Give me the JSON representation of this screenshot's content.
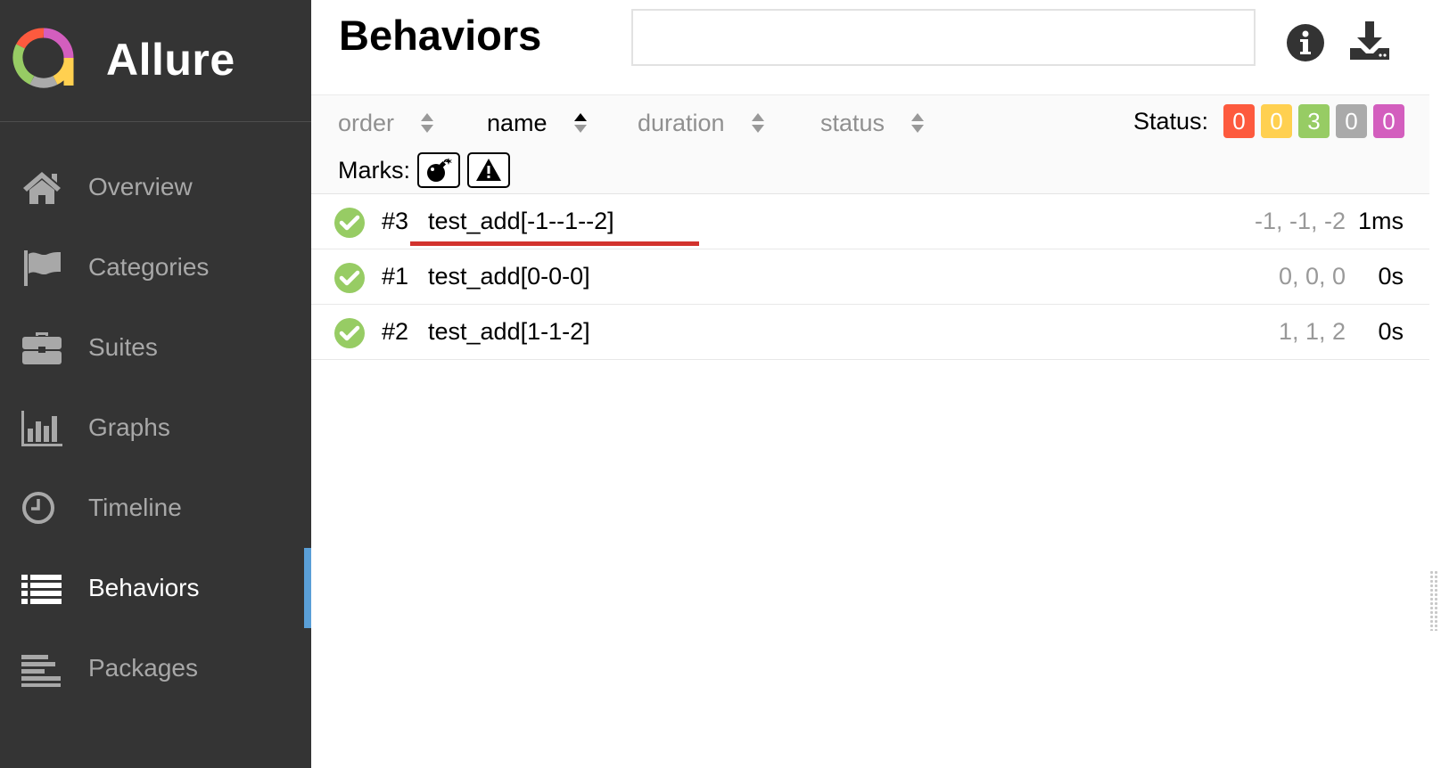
{
  "app": {
    "brand_name": "Allure",
    "logo_colors": [
      "#97cc64",
      "#fd5a3e",
      "#aaaaaa",
      "#ffd050",
      "#d35ebe"
    ]
  },
  "sidebar": {
    "items": [
      {
        "label": "Overview",
        "icon": "home-icon",
        "active": false
      },
      {
        "label": "Categories",
        "icon": "flag-icon",
        "active": false
      },
      {
        "label": "Suites",
        "icon": "briefcase-icon",
        "active": false
      },
      {
        "label": "Graphs",
        "icon": "bar-chart-icon",
        "active": false
      },
      {
        "label": "Timeline",
        "icon": "clock-icon",
        "active": false
      },
      {
        "label": "Behaviors",
        "icon": "list-icon",
        "active": true
      },
      {
        "label": "Packages",
        "icon": "align-left-icon",
        "active": false
      }
    ],
    "accent_color": "#5a9fd7"
  },
  "header": {
    "title": "Behaviors",
    "search_value": "",
    "info_icon": "info-icon",
    "download_icon": "download-icon"
  },
  "toolbar": {
    "sorters": [
      {
        "label": "order",
        "active": false
      },
      {
        "label": "name",
        "active": true,
        "direction": "asc"
      },
      {
        "label": "duration",
        "active": false
      },
      {
        "label": "status",
        "active": false
      }
    ],
    "status_label": "Status:",
    "status_badges": [
      {
        "status": "failed",
        "count": "0",
        "color": "#fd5a3e"
      },
      {
        "status": "broken",
        "count": "0",
        "color": "#ffd050"
      },
      {
        "status": "passed",
        "count": "3",
        "color": "#97cc64"
      },
      {
        "status": "skipped",
        "count": "0",
        "color": "#aaaaaa"
      },
      {
        "status": "unknown",
        "count": "0",
        "color": "#d35ebe"
      }
    ],
    "marks_label": "Marks:",
    "marks": [
      {
        "icon": "bomb-icon"
      },
      {
        "icon": "warning-icon"
      }
    ]
  },
  "tests": [
    {
      "order": "#3",
      "name": "test_add[-1--1--2]",
      "params": "-1, -1, -2",
      "duration": "1ms",
      "status": "passed",
      "highlighted": true
    },
    {
      "order": "#1",
      "name": "test_add[0-0-0]",
      "params": "0, 0, 0",
      "duration": "0s",
      "status": "passed",
      "highlighted": false
    },
    {
      "order": "#2",
      "name": "test_add[1-1-2]",
      "params": "1, 1, 2",
      "duration": "0s",
      "status": "passed",
      "highlighted": false
    }
  ],
  "colors": {
    "passed": "#97cc64",
    "highlight_underline": "#d2322d"
  }
}
